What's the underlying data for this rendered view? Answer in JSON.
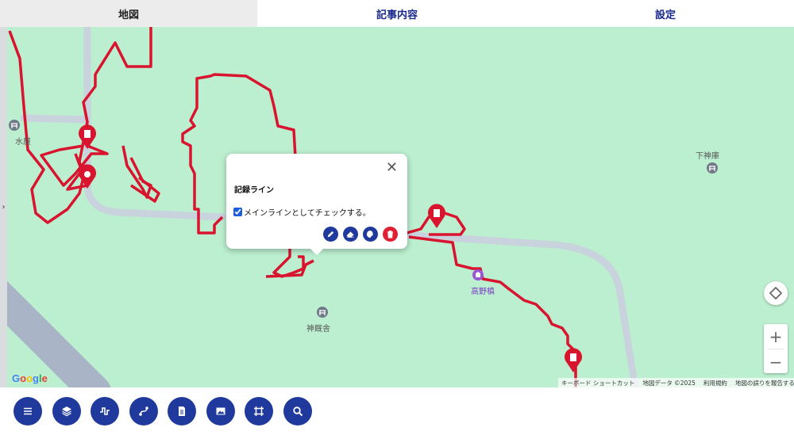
{
  "tabs": [
    {
      "label": "地図",
      "active": true
    },
    {
      "label": "記事内容",
      "active": false
    },
    {
      "label": "設定",
      "active": false
    }
  ],
  "map": {
    "pois": [
      {
        "label": "水屋",
        "color": "gray"
      },
      {
        "label": "下神庫",
        "color": "gray"
      },
      {
        "label": "高野槙",
        "color": "purple"
      },
      {
        "label": "神厩舎",
        "color": "gray"
      }
    ],
    "side_handle": "›",
    "google_logo": "Google",
    "attribution": {
      "shortcuts": "キーボード ショートカット",
      "map_data": "地図データ ©2025",
      "terms": "利用規約",
      "report": "地図の誤りを報告する"
    },
    "zoom_in": "+",
    "zoom_out": "−",
    "colors": {
      "background": "#bcefd0",
      "route": "#d8142e",
      "road": "#c9d3dd"
    }
  },
  "popup": {
    "title": "記録ライン",
    "close": "✕",
    "checkbox_label": "メインラインとしてチェックする。",
    "checkbox_checked": true,
    "actions": [
      "pencil-icon",
      "eraser-icon",
      "palette-icon",
      "trash-icon"
    ]
  },
  "toolbar": {
    "buttons": [
      "menu-icon",
      "layers-icon",
      "line-icon",
      "route-icon",
      "document-icon",
      "image-icon",
      "crop-icon",
      "search-icon"
    ],
    "color": "#1f3a9c"
  }
}
